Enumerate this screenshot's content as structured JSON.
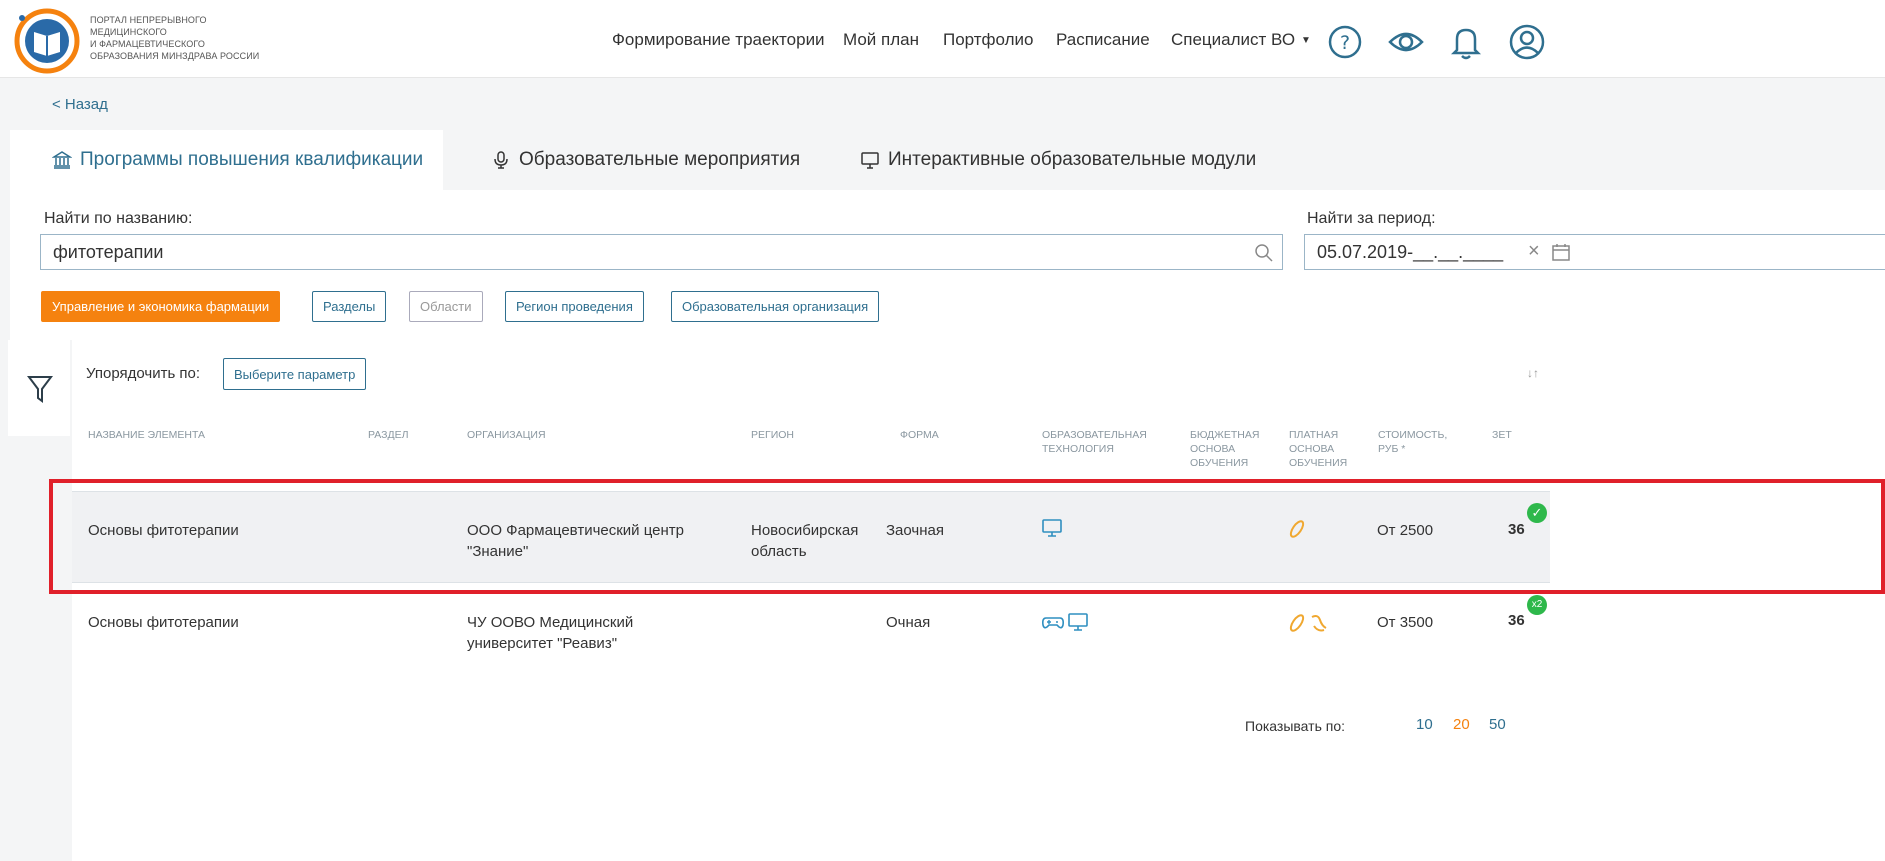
{
  "header": {
    "logo_lines": [
      "ПОРТАЛ НЕПРЕРЫВНОГО",
      "МЕДИЦИНСКОГО",
      "И ФАРМАЦЕВТИЧЕСКОГО",
      "ОБРАЗОВАНИЯ МИНЗДРАВА РОССИИ"
    ],
    "nav": [
      "Формирование траектории",
      "Мой план",
      "Портфолио",
      "Расписание",
      "Специалист ВО"
    ],
    "icons": [
      "help-icon",
      "eye-icon",
      "bell-icon",
      "user-icon"
    ]
  },
  "back": "< Назад",
  "tabs": [
    {
      "label": "Программы повышения квалификации",
      "icon": "building-icon",
      "active": true
    },
    {
      "label": "Образовательные мероприятия",
      "icon": "microphone-icon",
      "active": false
    },
    {
      "label": "Интерактивные образовательные модули",
      "icon": "monitor-icon",
      "active": false
    }
  ],
  "search": {
    "label": "Найти по названию:",
    "value": "фитотерапии",
    "period_label": "Найти за период:",
    "period_value": "05.07.2019-__.__.____"
  },
  "filters": [
    {
      "label": "Управление и экономика фармации",
      "state": "active"
    },
    {
      "label": "Разделы",
      "state": "normal"
    },
    {
      "label": "Области",
      "state": "disabled"
    },
    {
      "label": "Регион проведения",
      "state": "normal"
    },
    {
      "label": "Образовательная организация",
      "state": "normal"
    }
  ],
  "sort": {
    "label": "Упорядочить по:",
    "button": "Выберите параметр",
    "direction": "↓↑"
  },
  "table": {
    "headers": {
      "name": "НАЗВАНИЕ ЭЛЕМЕНТА",
      "section": "РАЗДЕЛ",
      "org": "ОРГАНИЗАЦИЯ",
      "region": "РЕГИОН",
      "form": "ФОРМА",
      "tech": [
        "ОБРАЗОВАТЕЛЬНАЯ",
        "ТЕХНОЛОГИЯ"
      ],
      "budget": [
        "БЮДЖЕТНАЯ",
        "ОСНОВА",
        "ОБУЧЕНИЯ"
      ],
      "paid": [
        "ПЛАТНАЯ",
        "ОСНОВА",
        "ОБУЧЕНИЯ"
      ],
      "cost": [
        "СТОИМОСТЬ,",
        "РУБ *"
      ],
      "zet": "ЗЕТ"
    },
    "rows": [
      {
        "name": "Основы фитотерапии",
        "org": [
          "ООО Фармацевтический центр",
          "\"Знание\""
        ],
        "region": [
          "Новосибирская",
          "область"
        ],
        "form": "Заочная",
        "tech_icons": [
          "monitor-icon"
        ],
        "paid_icons": [
          "coin-icon"
        ],
        "cost": "От 2500",
        "zet": "36",
        "badge": "✓"
      },
      {
        "name": "Основы фитотерапии",
        "org": [
          "ЧУ ООВО Медицинский",
          "университет \"Реавиз\""
        ],
        "region": [
          "",
          ""
        ],
        "form": "Очная",
        "tech_icons": [
          "gamepad-icon",
          "monitor-icon"
        ],
        "paid_icons": [
          "coin-icon",
          "handshake-icon"
        ],
        "cost": "От 3500",
        "zet": "36",
        "badge": "x2"
      }
    ]
  },
  "pager": {
    "label": "Показывать по:",
    "sizes": [
      "10",
      "20",
      "50"
    ],
    "active": "20"
  },
  "colors": {
    "accent": "#2f6f8f",
    "orange": "#f5820f",
    "highlight": "#e0202a",
    "badge": "#2eb84b"
  }
}
